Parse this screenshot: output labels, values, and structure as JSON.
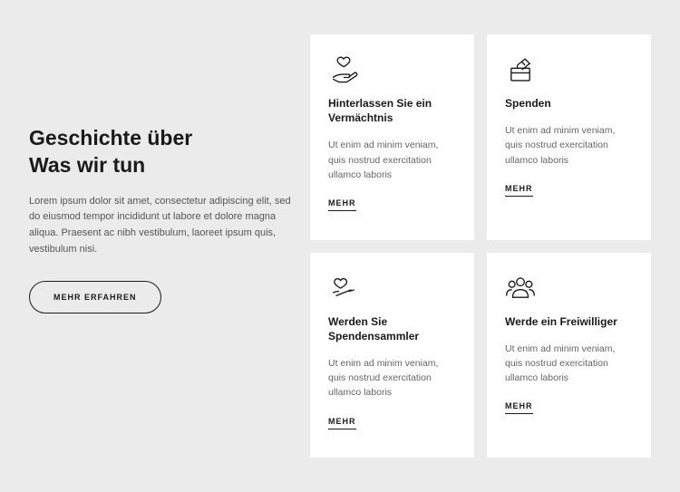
{
  "intro": {
    "heading_l1": "Geschichte über",
    "heading_l2": "Was wir tun",
    "body": "Lorem ipsum dolor sit amet, consectetur adipiscing elit, sed do eiusmod tempor incididunt ut labore et dolore magna aliqua. Praesent ac nibh vestibulum, laoreet ipsum quis, vestibulum nisi.",
    "cta": "MEHR ERFAHREN"
  },
  "cards": [
    {
      "icon": "hand-heart",
      "title": "Hinterlassen Sie ein Vermächtnis",
      "body": "Ut enim ad minim veniam, quis nostrud exercitation ullamco laboris",
      "more": "MEHR"
    },
    {
      "icon": "donation-box",
      "title": "Spenden",
      "body": "Ut enim ad minim veniam, quis nostrud exercitation ullamco laboris",
      "more": "MEHR"
    },
    {
      "icon": "hands-heart",
      "title": "Werden Sie Spendensammler",
      "body": "Ut enim ad minim veniam, quis nostrud exercitation ullamco laboris",
      "more": "MEHR"
    },
    {
      "icon": "group",
      "title": "Werde ein Freiwilliger",
      "body": "Ut enim ad minim veniam, quis nostrud exercitation ullamco laboris",
      "more": "MEHR"
    }
  ]
}
